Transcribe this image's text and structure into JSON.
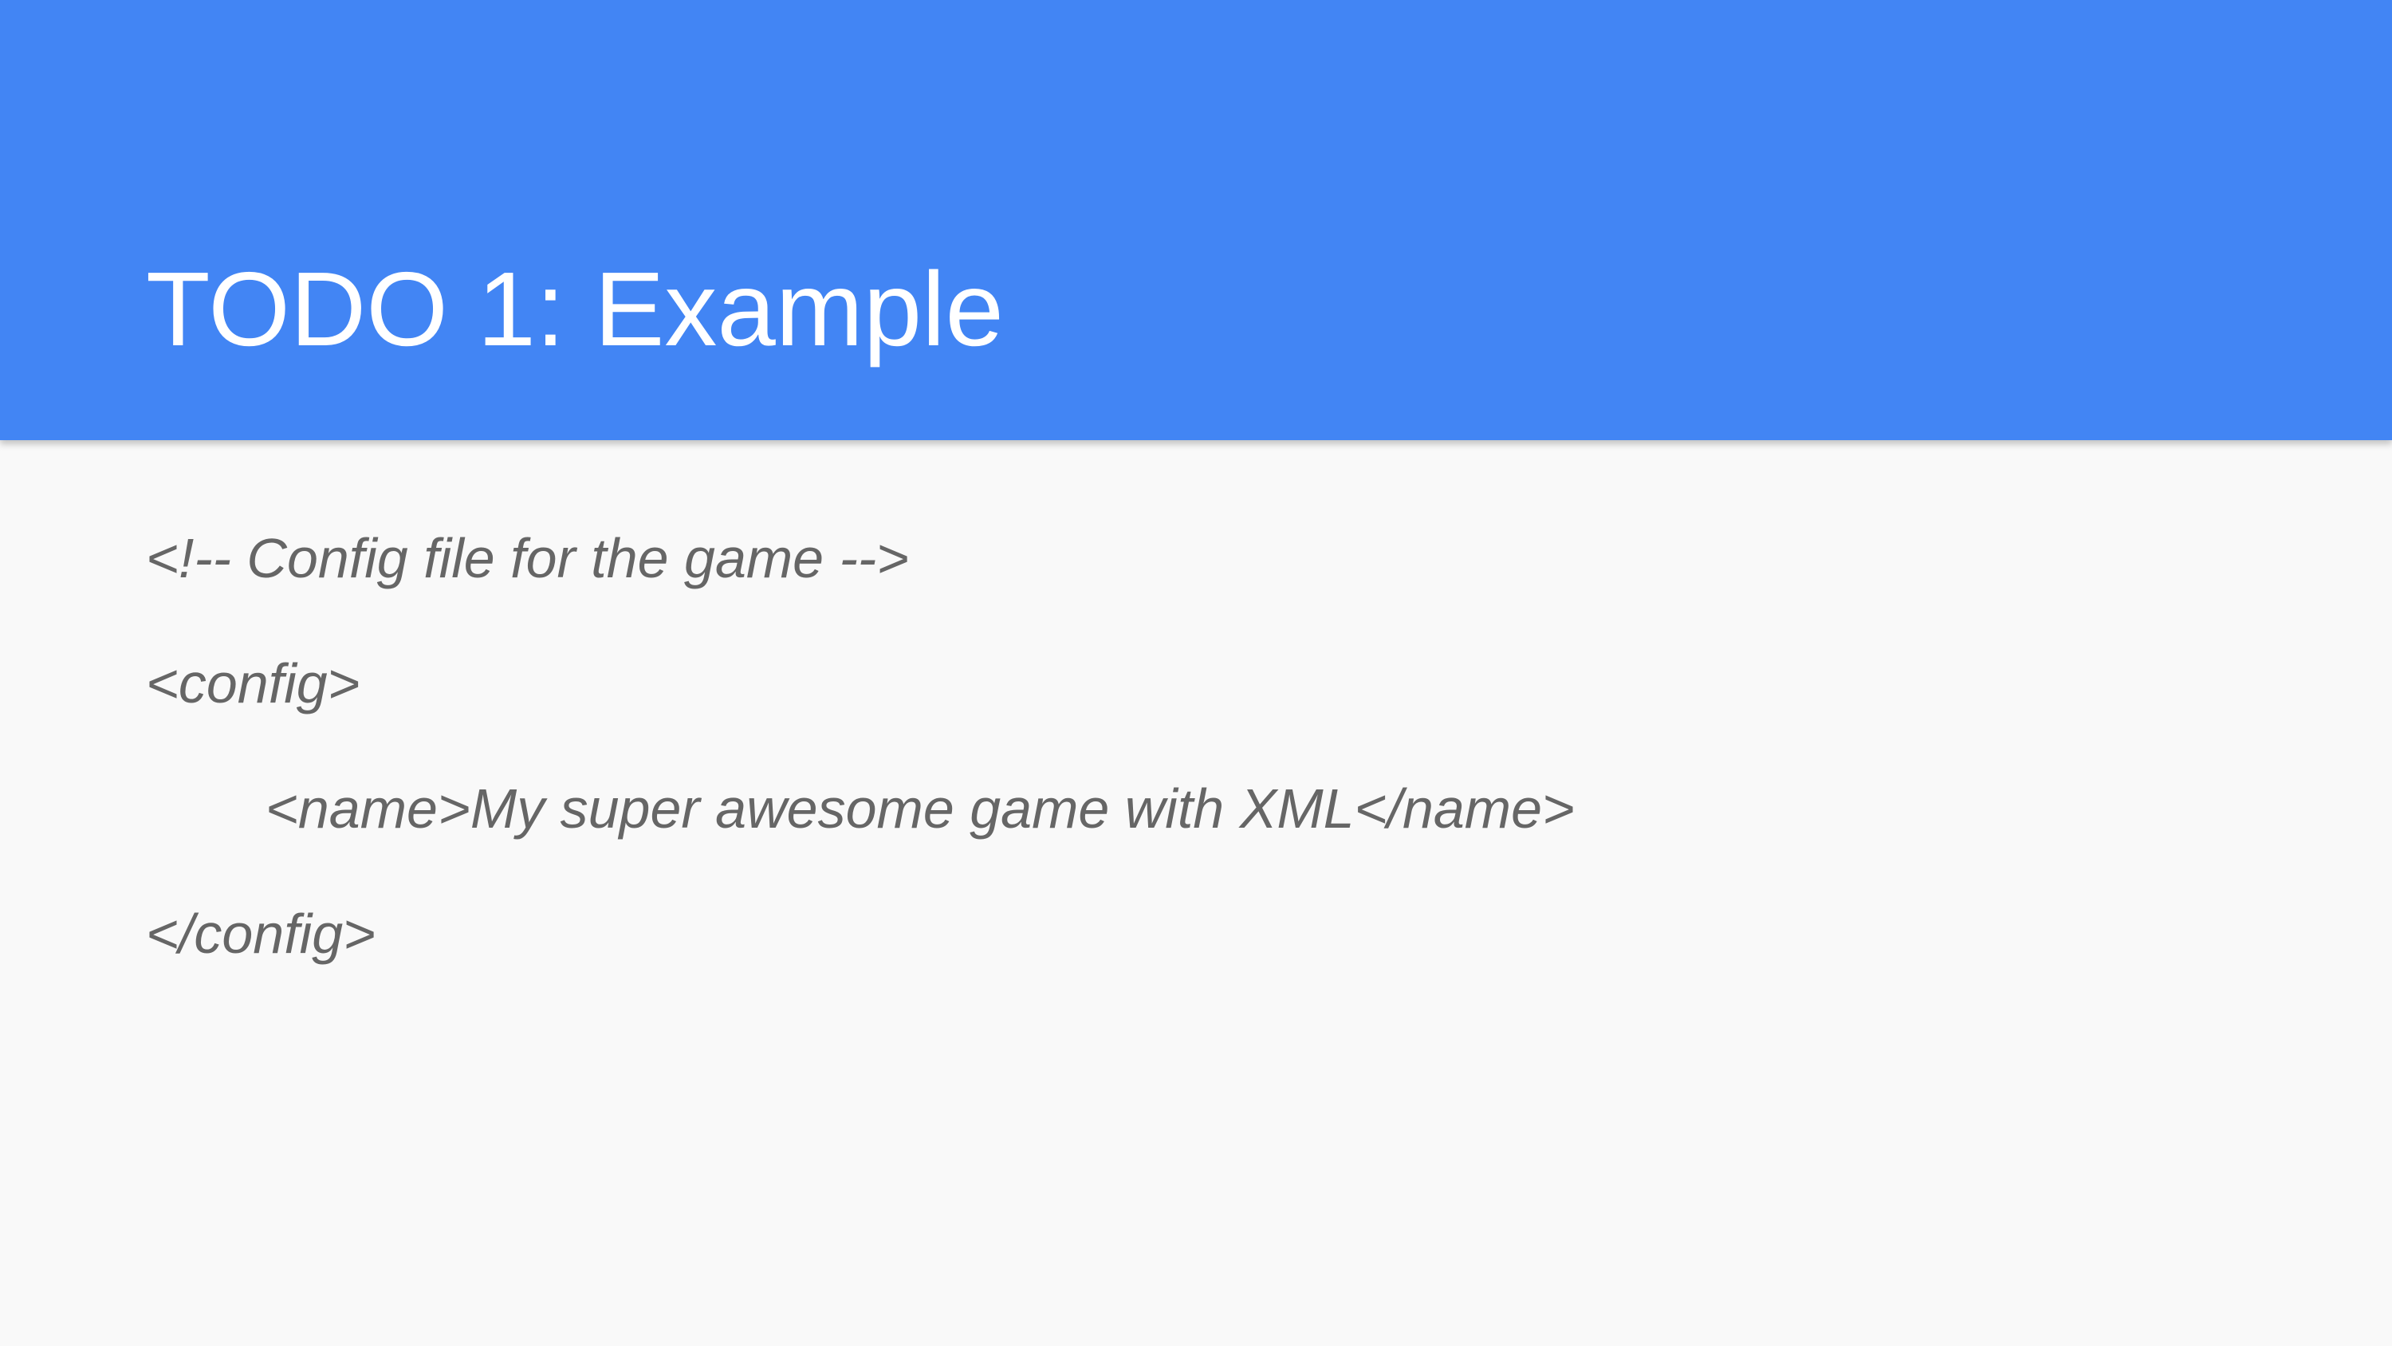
{
  "slide": {
    "title": "TODO 1: Example",
    "code_lines": [
      "<!-- Config file for the game -->",
      "<config>",
      "<name>My super awesome game with XML</name>",
      "</config>"
    ]
  },
  "colors": {
    "header_background": "#4285f4",
    "page_background": "#f9f9f9",
    "title_text": "#ffffff",
    "body_text": "#666666"
  }
}
